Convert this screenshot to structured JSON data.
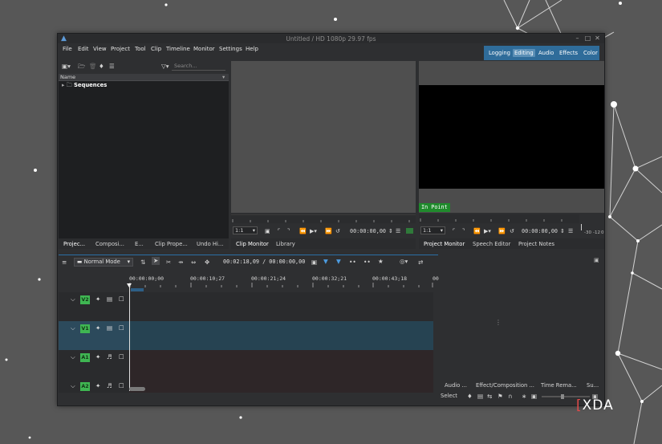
{
  "window": {
    "title": "Untitled / HD 1080p 29.97 fps"
  },
  "icons": {
    "app": "kdenlive-logo-icon",
    "minimize": "minimize-icon",
    "maximize": "maximize-icon",
    "close": "close-icon"
  },
  "menu": [
    "File",
    "Edit",
    "View",
    "Project",
    "Tool",
    "Clip",
    "Timeline",
    "Monitor",
    "Settings",
    "Help"
  ],
  "layouts": {
    "items": [
      "Logging",
      "Editing",
      "Audio",
      "Effects",
      "Color"
    ],
    "active": "Editing",
    "accent": "#2f6c9a"
  },
  "bin": {
    "search_placeholder": "Search...",
    "column_name": "Name",
    "folders": [
      "Sequences"
    ],
    "tabs": [
      "Projec...",
      "Composi...",
      "E...",
      "Clip Prope...",
      "Undo Hi..."
    ]
  },
  "clip_monitor": {
    "zoom": "1:1",
    "timecode": "00:00:00,00",
    "tabs": [
      "Clip Monitor",
      "Library"
    ]
  },
  "project_monitor": {
    "zoom": "1:1",
    "timecode": "00:00:00,00",
    "in_point_label": "In Point",
    "in_point_color": "#1f8a2c",
    "meter_labels": [
      "-30",
      "-12",
      "0"
    ],
    "tabs": [
      "Project Monitor",
      "Speech Editor",
      "Project Notes"
    ]
  },
  "timeline": {
    "mode": "Normal Mode",
    "position": "00:02:18,09",
    "duration": "00:00:00,00",
    "ruler": [
      "00:00:00;00",
      "00:00:10;27",
      "00:00:21;24",
      "00:00:32;21",
      "00:00:43;18",
      "00"
    ],
    "tracks": [
      {
        "id": "V2",
        "kind": "video"
      },
      {
        "id": "V1",
        "kind": "video"
      },
      {
        "id": "A1",
        "kind": "audio"
      },
      {
        "id": "A2",
        "kind": "audio"
      }
    ],
    "track_tag_color": "#3fb652",
    "selected_track_color": "#2c4a5c"
  },
  "right_panel": {
    "tabs": [
      "Audio ...",
      "Effect/Composition ...",
      "Time Rema...",
      "Su..."
    ],
    "select_label": "Select"
  },
  "watermark": {
    "bracket": "[",
    "text": "XDA"
  }
}
